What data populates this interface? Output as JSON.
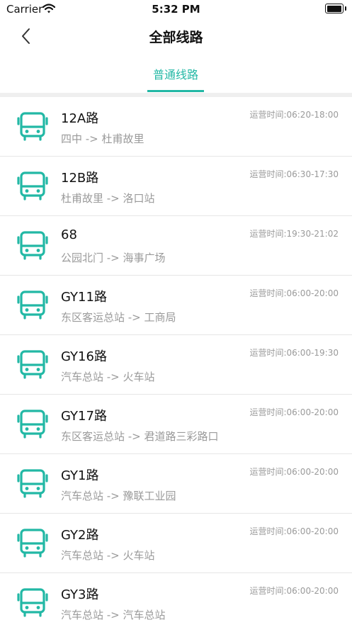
{
  "status_bar": {
    "carrier": "Carrier",
    "time": "5:32 PM"
  },
  "nav": {
    "title": "全部线路",
    "back_icon": "chevron-left-icon"
  },
  "tabs": [
    {
      "label": "普通线路",
      "active": true
    }
  ],
  "colors": {
    "accent": "#22b8a5",
    "secondary_text": "#9a9a9a"
  },
  "routes": [
    {
      "name": "12A路",
      "path": "四中 -> 杜甫故里",
      "hours": "运营时间:06:20-18:00"
    },
    {
      "name": "12B路",
      "path": "杜甫故里 -> 洛口站",
      "hours": "运营时间:06:30-17:30"
    },
    {
      "name": "68",
      "path": "公园北门 -> 海事广场",
      "hours": "运营时间:19:30-21:02"
    },
    {
      "name": "GY11路",
      "path": "东区客运总站 -> 工商局",
      "hours": "运营时间:06:00-20:00"
    },
    {
      "name": "GY16路",
      "path": "汽车总站 -> 火车站",
      "hours": "运营时间:06:00-19:30"
    },
    {
      "name": "GY17路",
      "path": "东区客运总站 -> 君道路三彩路口",
      "hours": "运营时间:06:00-20:00"
    },
    {
      "name": "GY1路",
      "path": "汽车总站 -> 豫联工业园",
      "hours": "运营时间:06:00-20:00"
    },
    {
      "name": "GY2路",
      "path": "汽车总站 -> 火车站",
      "hours": "运营时间:06:00-20:00"
    },
    {
      "name": "GY3路",
      "path": "汽车总站 -> 汽车总站",
      "hours": "运营时间:06:00-20:00"
    }
  ]
}
